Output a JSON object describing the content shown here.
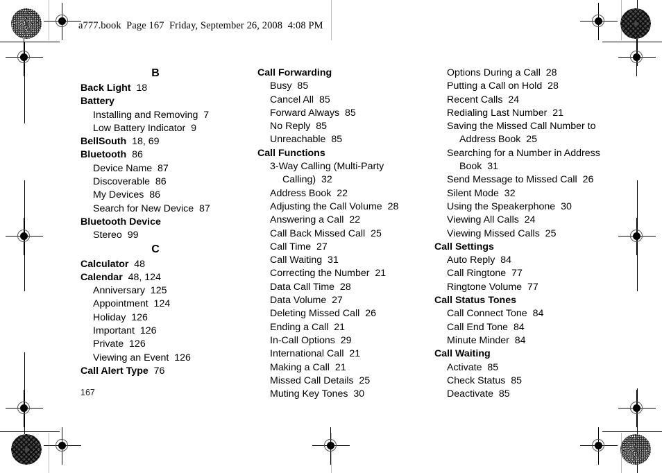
{
  "document": {
    "banner": "a777.book  Page 167  Friday, September 26, 2008  4:08 PM",
    "folio": "167",
    "page_number": 167
  },
  "index": {
    "columns": [
      {
        "id": "column-1",
        "blocks": [
          {
            "type": "letter",
            "letter": "B"
          },
          {
            "type": "entry",
            "level": 1,
            "text": "Back Light",
            "pages": "18"
          },
          {
            "type": "entry",
            "level": 1,
            "text": "Battery",
            "pages": ""
          },
          {
            "type": "entry",
            "level": 2,
            "text": "Installing and Removing",
            "pages": "7"
          },
          {
            "type": "entry",
            "level": 2,
            "text": "Low Battery Indicator",
            "pages": "9"
          },
          {
            "type": "entry",
            "level": 1,
            "text": "BellSouth",
            "pages": "18, 69"
          },
          {
            "type": "entry",
            "level": 1,
            "text": "Bluetooth",
            "pages": "86"
          },
          {
            "type": "entry",
            "level": 2,
            "text": "Device Name",
            "pages": "87"
          },
          {
            "type": "entry",
            "level": 2,
            "text": "Discoverable",
            "pages": "86"
          },
          {
            "type": "entry",
            "level": 2,
            "text": "My Devices",
            "pages": "86"
          },
          {
            "type": "entry",
            "level": 2,
            "text": "Search for New Device",
            "pages": "87"
          },
          {
            "type": "entry",
            "level": 1,
            "text": "Bluetooth Device",
            "pages": ""
          },
          {
            "type": "entry",
            "level": 2,
            "text": "Stereo",
            "pages": "99"
          },
          {
            "type": "letter",
            "letter": "C"
          },
          {
            "type": "entry",
            "level": 1,
            "text": "Calculator",
            "pages": "48"
          },
          {
            "type": "entry",
            "level": 1,
            "text": "Calendar",
            "pages": "48, 124"
          },
          {
            "type": "entry",
            "level": 2,
            "text": "Anniversary",
            "pages": "125"
          },
          {
            "type": "entry",
            "level": 2,
            "text": "Appointment",
            "pages": "124"
          },
          {
            "type": "entry",
            "level": 2,
            "text": "Holiday",
            "pages": "126"
          },
          {
            "type": "entry",
            "level": 2,
            "text": "Important",
            "pages": "126"
          },
          {
            "type": "entry",
            "level": 2,
            "text": "Private",
            "pages": "126"
          },
          {
            "type": "entry",
            "level": 2,
            "text": "Viewing an Event",
            "pages": "126"
          },
          {
            "type": "entry",
            "level": 1,
            "text": "Call Alert Type",
            "pages": "76"
          }
        ]
      },
      {
        "id": "column-2",
        "blocks": [
          {
            "type": "entry",
            "level": 1,
            "text": "Call Forwarding",
            "pages": ""
          },
          {
            "type": "entry",
            "level": 2,
            "text": "Busy",
            "pages": "85"
          },
          {
            "type": "entry",
            "level": 2,
            "text": "Cancel All",
            "pages": "85"
          },
          {
            "type": "entry",
            "level": 2,
            "text": "Forward Always",
            "pages": "85"
          },
          {
            "type": "entry",
            "level": 2,
            "text": "No Reply",
            "pages": "85"
          },
          {
            "type": "entry",
            "level": 2,
            "text": "Unreachable",
            "pages": "85"
          },
          {
            "type": "entry",
            "level": 1,
            "text": "Call Functions",
            "pages": ""
          },
          {
            "type": "entry",
            "level": 2,
            "text": "3-Way Calling (Multi-Party Calling)",
            "pages": "32",
            "wraps": true
          },
          {
            "type": "entry",
            "level": 2,
            "text": "Address Book",
            "pages": "22"
          },
          {
            "type": "entry",
            "level": 2,
            "text": "Adjusting the Call Volume",
            "pages": "28"
          },
          {
            "type": "entry",
            "level": 2,
            "text": "Answering a Call",
            "pages": "22"
          },
          {
            "type": "entry",
            "level": 2,
            "text": "Call Back Missed Call",
            "pages": "25"
          },
          {
            "type": "entry",
            "level": 2,
            "text": "Call Time",
            "pages": "27"
          },
          {
            "type": "entry",
            "level": 2,
            "text": "Call Waiting",
            "pages": "31"
          },
          {
            "type": "entry",
            "level": 2,
            "text": "Correcting the Number",
            "pages": "21"
          },
          {
            "type": "entry",
            "level": 2,
            "text": "Data Call Time",
            "pages": "28"
          },
          {
            "type": "entry",
            "level": 2,
            "text": "Data Volume",
            "pages": "27"
          },
          {
            "type": "entry",
            "level": 2,
            "text": "Deleting Missed Call",
            "pages": "26"
          },
          {
            "type": "entry",
            "level": 2,
            "text": "Ending a Call",
            "pages": "21"
          },
          {
            "type": "entry",
            "level": 2,
            "text": "In-Call Options",
            "pages": "29"
          },
          {
            "type": "entry",
            "level": 2,
            "text": "International Call",
            "pages": "21"
          },
          {
            "type": "entry",
            "level": 2,
            "text": "Making a Call",
            "pages": "21"
          },
          {
            "type": "entry",
            "level": 2,
            "text": "Missed Call Details",
            "pages": "25"
          },
          {
            "type": "entry",
            "level": 2,
            "text": "Muting Key Tones",
            "pages": "30"
          }
        ]
      },
      {
        "id": "column-3",
        "blocks": [
          {
            "type": "entry",
            "level": 2,
            "text": "Options During a Call",
            "pages": "28"
          },
          {
            "type": "entry",
            "level": 2,
            "text": "Putting a Call on Hold",
            "pages": "28"
          },
          {
            "type": "entry",
            "level": 2,
            "text": "Recent Calls",
            "pages": "24"
          },
          {
            "type": "entry",
            "level": 2,
            "text": "Redialing Last Number",
            "pages": "21"
          },
          {
            "type": "entry",
            "level": 2,
            "text": "Saving the Missed Call Number to Address Book",
            "pages": "25",
            "wraps": true
          },
          {
            "type": "entry",
            "level": 2,
            "text": "Searching for a Number in Address Book",
            "pages": "31",
            "wraps": true
          },
          {
            "type": "entry",
            "level": 2,
            "text": "Send Message to Missed Call",
            "pages": "26"
          },
          {
            "type": "entry",
            "level": 2,
            "text": "Silent Mode",
            "pages": "32"
          },
          {
            "type": "entry",
            "level": 2,
            "text": "Using the Speakerphone",
            "pages": "30"
          },
          {
            "type": "entry",
            "level": 2,
            "text": "Viewing All Calls",
            "pages": "24"
          },
          {
            "type": "entry",
            "level": 2,
            "text": "Viewing Missed Calls",
            "pages": "25"
          },
          {
            "type": "entry",
            "level": 1,
            "text": "Call Settings",
            "pages": ""
          },
          {
            "type": "entry",
            "level": 2,
            "text": "Auto Reply",
            "pages": "84"
          },
          {
            "type": "entry",
            "level": 2,
            "text": "Call Ringtone",
            "pages": "77"
          },
          {
            "type": "entry",
            "level": 2,
            "text": "Ringtone Volume",
            "pages": "77"
          },
          {
            "type": "entry",
            "level": 1,
            "text": "Call Status Tones",
            "pages": ""
          },
          {
            "type": "entry",
            "level": 2,
            "text": "Call Connect Tone",
            "pages": "84"
          },
          {
            "type": "entry",
            "level": 2,
            "text": "Call End Tone",
            "pages": "84"
          },
          {
            "type": "entry",
            "level": 2,
            "text": "Minute Minder",
            "pages": "84"
          },
          {
            "type": "entry",
            "level": 1,
            "text": "Call Waiting",
            "pages": ""
          },
          {
            "type": "entry",
            "level": 2,
            "text": "Activate",
            "pages": "85"
          },
          {
            "type": "entry",
            "level": 2,
            "text": "Check Status",
            "pages": "85"
          },
          {
            "type": "entry",
            "level": 2,
            "text": "Deactivate",
            "pages": "85"
          }
        ]
      }
    ]
  },
  "print_marks": {
    "registration_targets": 8,
    "rosette_targets": 4,
    "colors": {
      "ink": "#000000",
      "trim_rule_light": "#b9b9b9"
    }
  }
}
